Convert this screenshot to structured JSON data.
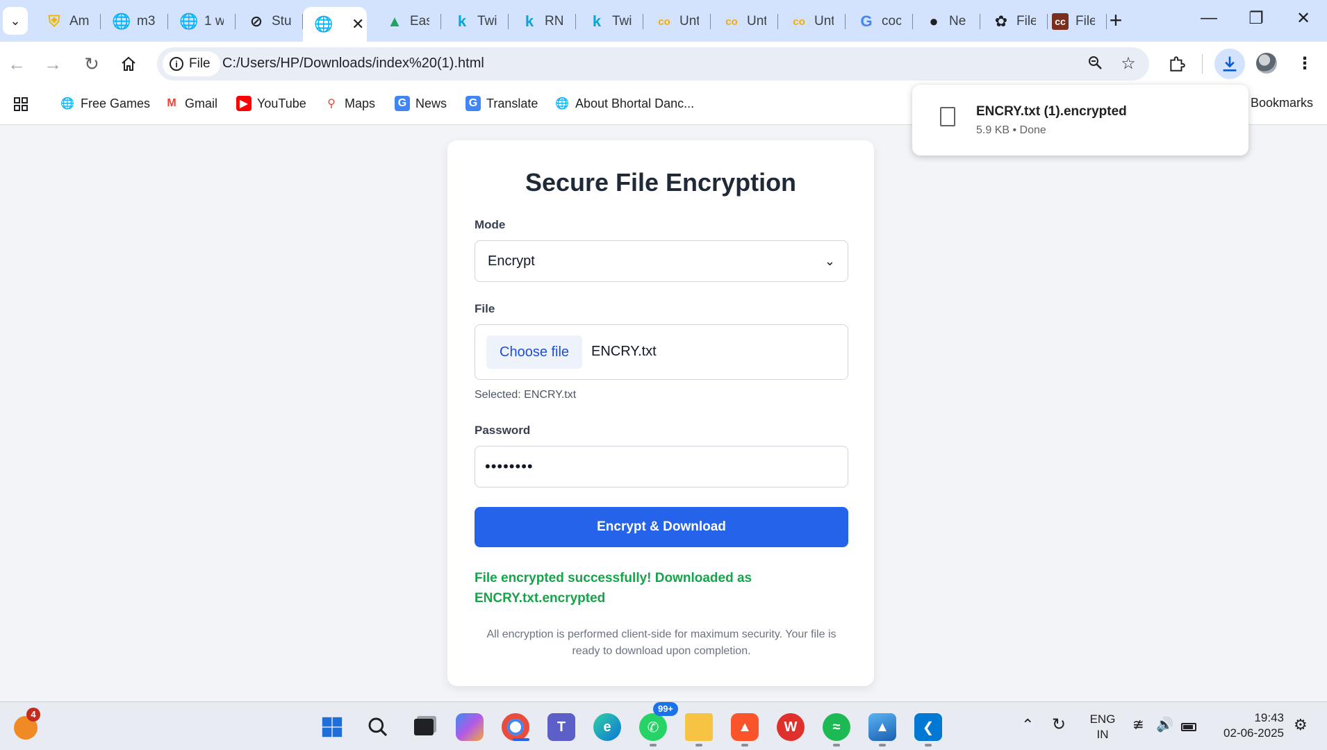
{
  "browser": {
    "tabs": [
      {
        "title": "Am",
        "icon": "shield-icon",
        "color": "#f0b400"
      },
      {
        "title": "m3",
        "icon": "globe-icon",
        "color": "#5f6368"
      },
      {
        "title": "1 w",
        "icon": "globe-icon",
        "color": "#5f6368"
      },
      {
        "title": "Stu",
        "icon": "slash-circle-icon",
        "color": "#202124"
      },
      {
        "title": "",
        "icon": "globe-icon",
        "color": "#5f6368",
        "active": true
      },
      {
        "title": "Eas",
        "icon": "drive-icon",
        "color": "#1fa463"
      },
      {
        "title": "Twi",
        "icon": "k-icon",
        "color": "#0aa4d6"
      },
      {
        "title": "RN",
        "icon": "k-icon",
        "color": "#0aa4d6"
      },
      {
        "title": "Twi",
        "icon": "k-icon",
        "color": "#0aa4d6"
      },
      {
        "title": "Unt",
        "icon": "colab-icon",
        "color": "#f9ab00"
      },
      {
        "title": "Unt",
        "icon": "colab-icon",
        "color": "#f9ab00"
      },
      {
        "title": "Unt",
        "icon": "colab-icon",
        "color": "#f9ab00"
      },
      {
        "title": "coc",
        "icon": "google-icon",
        "color": "#4285f4"
      },
      {
        "title": "Ne",
        "icon": "github-icon",
        "color": "#202124"
      },
      {
        "title": "File",
        "icon": "openai-icon",
        "color": "#202124"
      },
      {
        "title": "File",
        "icon": "cc-icon",
        "color": "#7a2e1e"
      }
    ],
    "address": {
      "chip_label": "File",
      "url": "C:/Users/HP/Downloads/index%20(1).html"
    },
    "bookmarks": [
      {
        "label": "Free Games",
        "icon": "globe-color-icon"
      },
      {
        "label": "Gmail",
        "icon": "gmail-icon"
      },
      {
        "label": "YouTube",
        "icon": "youtube-icon"
      },
      {
        "label": "Maps",
        "icon": "maps-pin-icon"
      },
      {
        "label": "News",
        "icon": "news-icon"
      },
      {
        "label": "Translate",
        "icon": "translate-icon"
      },
      {
        "label": "About Bhortal Danc...",
        "icon": "globe-icon"
      }
    ],
    "bookmarks_right": "Bookmarks",
    "download": {
      "filename": "ENCRY.txt (1).encrypted",
      "status": "5.9 KB • Done"
    }
  },
  "page": {
    "title": "Secure File Encryption",
    "mode_label": "Mode",
    "mode_value": "Encrypt",
    "file_label": "File",
    "choose_button": "Choose file",
    "chosen_file": "ENCRY.txt",
    "selected_note": "Selected: ENCRY.txt",
    "password_label": "Password",
    "password_mask": "••••••••",
    "submit_button": "Encrypt & Download",
    "success_message": "File encrypted successfully! Downloaded as ENCRY.txt.encrypted",
    "footnote": "All encryption is performed client-side for maximum security. Your file is ready to download upon completion.",
    "accent_color": "#2563eb",
    "success_color": "#16a34a"
  },
  "taskbar": {
    "start_badge": "4",
    "whatsapp_badge": "99+",
    "language_line1": "ENG",
    "language_line2": "IN",
    "time": "19:43",
    "date": "02-06-2025"
  }
}
